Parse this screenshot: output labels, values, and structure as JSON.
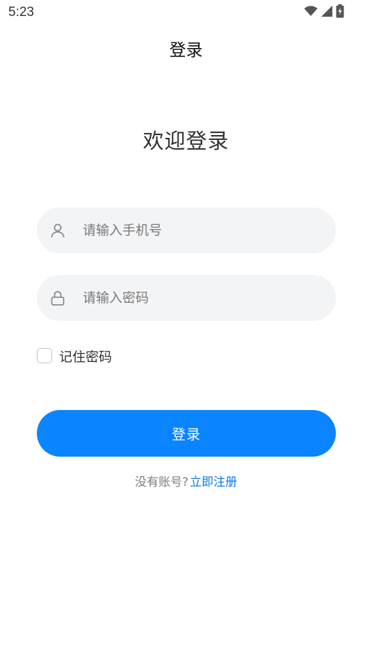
{
  "status_bar": {
    "time": "5:23",
    "icons": [
      "wifi-icon",
      "cellular-signal-icon",
      "battery-charging-icon"
    ]
  },
  "header": {
    "title": "登录"
  },
  "main": {
    "welcome_text": "欢迎登录",
    "phone_field": {
      "icon": "user-icon",
      "placeholder": "请输入手机号",
      "value": ""
    },
    "password_field": {
      "icon": "lock-icon",
      "placeholder": "请输入密码",
      "value": ""
    },
    "remember": {
      "label": "记住密码",
      "checked": false
    },
    "login_button": {
      "label": "登录",
      "color": "#0a84ff"
    },
    "register": {
      "prompt": "没有账号?",
      "link_label": "立即注册",
      "link_color": "#0a7ae6"
    }
  }
}
